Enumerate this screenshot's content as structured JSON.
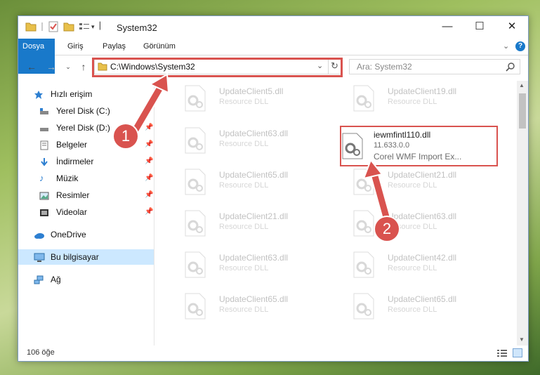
{
  "window": {
    "title": "System32",
    "controls": [
      "minimize",
      "maximize",
      "close"
    ]
  },
  "ribbon": {
    "tabs": [
      "Dosya",
      "Giriş",
      "Paylaş",
      "Görünüm"
    ]
  },
  "address": {
    "path": "C:\\Windows\\System32",
    "search_placeholder": "Ara: System32"
  },
  "sidebar": {
    "quick_access": "Hızlı erişim",
    "items": [
      {
        "label": "Yerel Disk (C:)",
        "icon": "drive-icon",
        "pinned": true
      },
      {
        "label": "Yerel Disk (D:)",
        "icon": "drive-icon",
        "pinned": true
      },
      {
        "label": "Belgeler",
        "icon": "documents-icon",
        "pinned": true
      },
      {
        "label": "İndirmeler",
        "icon": "download-icon",
        "pinned": true
      },
      {
        "label": "Müzik",
        "icon": "music-icon",
        "pinned": true
      },
      {
        "label": "Resimler",
        "icon": "pictures-icon",
        "pinned": true
      },
      {
        "label": "Videolar",
        "icon": "videos-icon",
        "pinned": true
      }
    ],
    "onedrive": "OneDrive",
    "this_pc": "Bu bilgisayar",
    "network": "Ağ"
  },
  "files": {
    "left": [
      {
        "name": "UpdateClient5.dll",
        "desc": "Resource DLL"
      },
      {
        "name": "UpdateClient63.dll",
        "desc": "Resource DLL"
      },
      {
        "name": "UpdateClient65.dll",
        "desc": "Resource DLL"
      },
      {
        "name": "UpdateClient21.dll",
        "desc": "Resource DLL"
      },
      {
        "name": "UpdateClient63.dll",
        "desc": "Resource DLL"
      },
      {
        "name": "UpdateClient65.dll",
        "desc": "Resource DLL"
      }
    ],
    "right": [
      {
        "name": "UpdateClient19.dll",
        "desc": "Resource DLL"
      },
      {
        "name": "iewmfintl110.dll",
        "version": "11.633.0.0",
        "desc": "Corel WMF Import Ex...",
        "highlighted": true
      },
      {
        "name": "UpdateClient21.dll",
        "desc": "Resource DLL"
      },
      {
        "name": "UpdateClient63.dll",
        "desc": "Resource DLL"
      },
      {
        "name": "UpdateClient42.dll",
        "desc": "Resource DLL"
      },
      {
        "name": "UpdateClient65.dll",
        "desc": "Resource DLL"
      }
    ]
  },
  "status": {
    "count": "106 öğe"
  },
  "annotations": {
    "step1": "1",
    "step2": "2"
  },
  "colors": {
    "accent": "#1979ca",
    "highlight_red": "#d9534f",
    "selection": "#cce8ff"
  }
}
